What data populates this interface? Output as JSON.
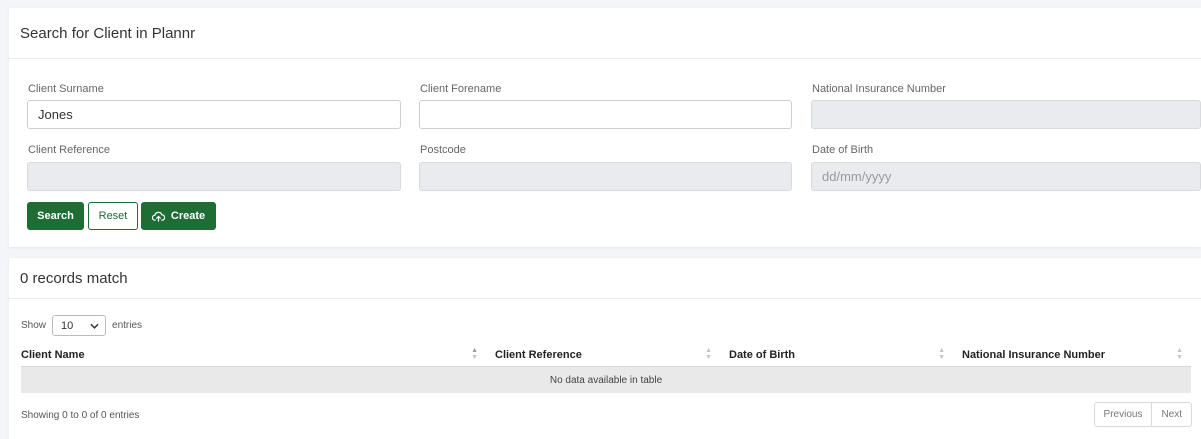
{
  "search_card": {
    "title": "Search for Client in Plannr",
    "fields": {
      "surname": {
        "label": "Client Surname",
        "value": "Jones"
      },
      "forename": {
        "label": "Client Forename",
        "value": ""
      },
      "ni_number": {
        "label": "National Insurance Number",
        "value": ""
      },
      "reference": {
        "label": "Client Reference",
        "value": ""
      },
      "postcode": {
        "label": "Postcode",
        "value": ""
      },
      "dob": {
        "label": "Date of Birth",
        "placeholder": "dd/mm/yyyy"
      }
    },
    "buttons": {
      "search": "Search",
      "reset": "Reset",
      "create": "Create"
    }
  },
  "results_card": {
    "title": "0 records match",
    "show_prefix": "Show",
    "page_length": "10",
    "show_suffix": "entries",
    "columns": [
      "Client Name",
      "Client Reference",
      "Date of Birth",
      "National Insurance Number"
    ],
    "empty_message": "No data available in table",
    "info": "Showing 0 to 0 of 0 entries",
    "pagination": {
      "previous": "Previous",
      "next": "Next"
    }
  },
  "colors": {
    "primary_green": "#1d6d35",
    "disabled_input_bg": "#e9ebee",
    "page_bg": "#f4f5f9"
  },
  "icons": {
    "create": "cloud-upload-icon",
    "select_arrow": "chevron-down-icon",
    "sort": "sort-icon"
  }
}
